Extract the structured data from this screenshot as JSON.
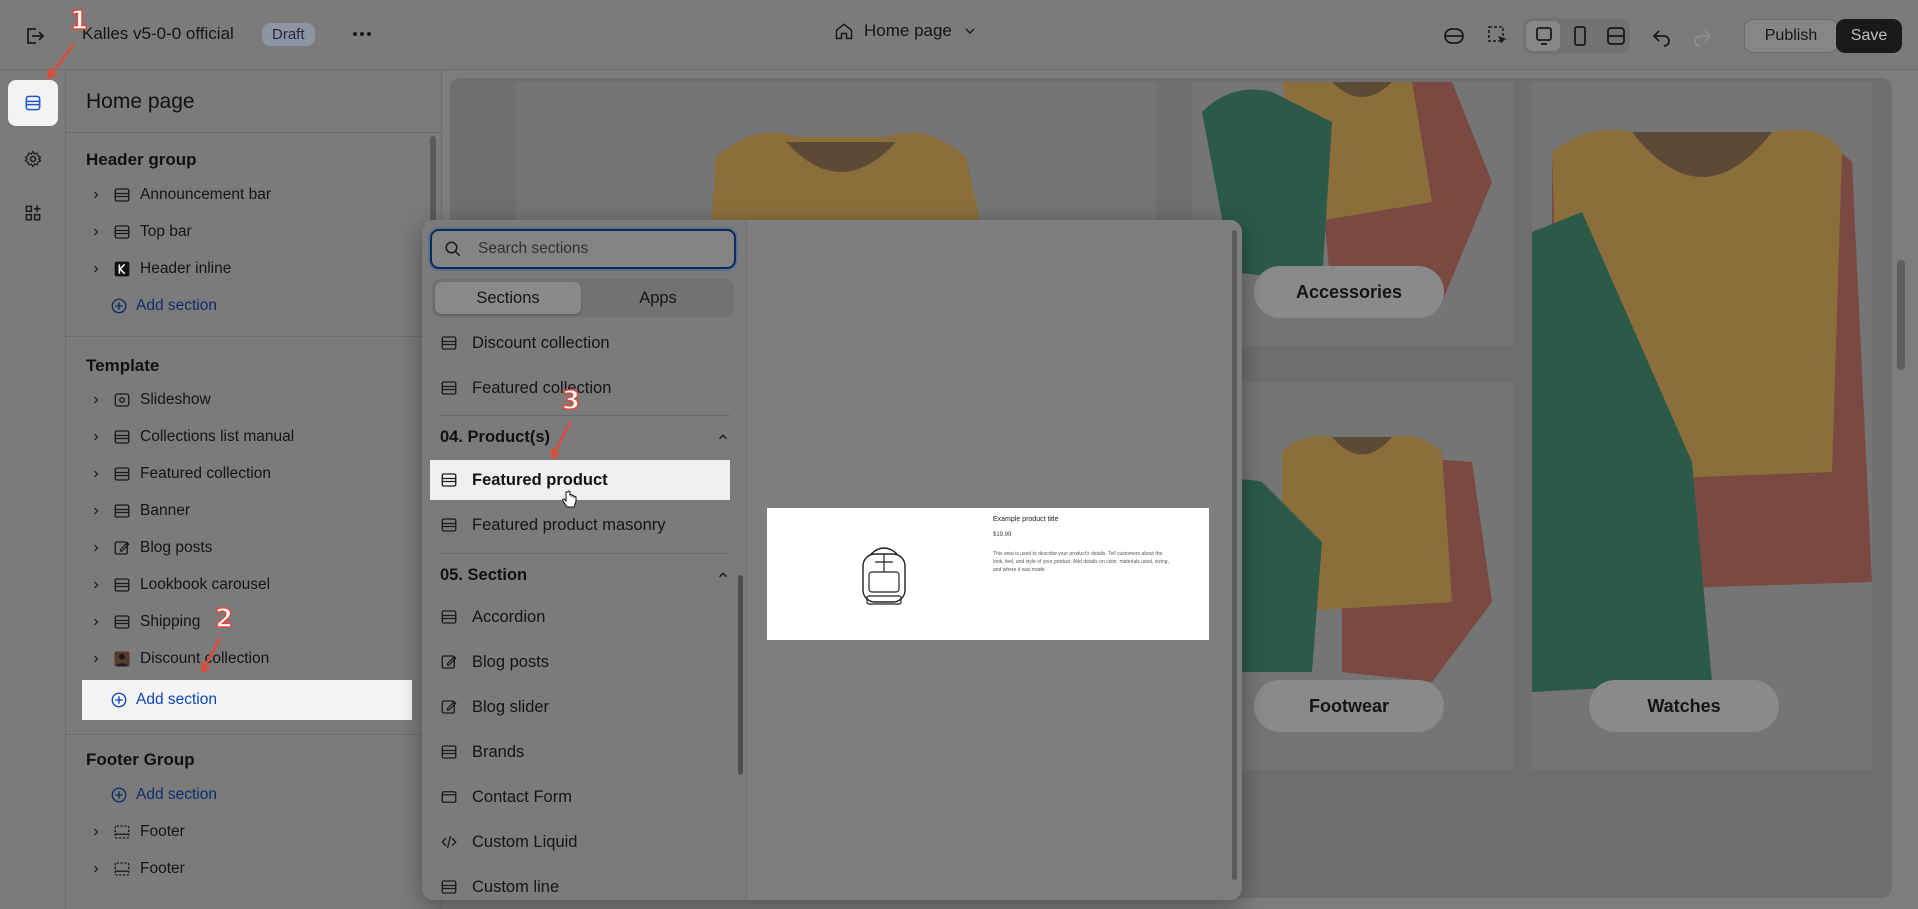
{
  "topbar": {
    "store_name": "Kalles v5-0-0 official",
    "status_badge": "Draft",
    "page_selector": "Home page",
    "publish_label": "Publish",
    "save_label": "Save"
  },
  "sidebar": {
    "title": "Home page",
    "header_group": {
      "heading": "Header group",
      "items": [
        {
          "label": "Announcement bar",
          "icon": "section-icon"
        },
        {
          "label": "Top bar",
          "icon": "section-icon"
        },
        {
          "label": "Header inline",
          "icon": "k-logo-icon"
        }
      ],
      "add_label": "Add section"
    },
    "template": {
      "heading": "Template",
      "items": [
        {
          "label": "Slideshow",
          "icon": "slideshow-icon"
        },
        {
          "label": "Collections list manual",
          "icon": "section-icon"
        },
        {
          "label": "Featured collection",
          "icon": "section-icon"
        },
        {
          "label": "Banner",
          "icon": "section-icon"
        },
        {
          "label": "Blog posts",
          "icon": "edit-icon"
        },
        {
          "label": "Lookbook carousel",
          "icon": "section-icon"
        },
        {
          "label": "Shipping",
          "icon": "section-icon"
        },
        {
          "label": "Discount collection",
          "icon": "person-image-icon"
        }
      ],
      "add_label": "Add section"
    },
    "footer_group": {
      "heading": "Footer Group",
      "add_label": "Add section",
      "items": [
        {
          "label": "Footer",
          "icon": "footer-icon"
        },
        {
          "label": "Footer",
          "icon": "footer-icon"
        }
      ]
    }
  },
  "picker": {
    "search_placeholder": "Search sections",
    "tabs": [
      "Sections",
      "Apps"
    ],
    "top_items": [
      "Discount collection",
      "Featured collection"
    ],
    "cat_products": "04. Product(s)",
    "product_items": [
      "Featured product",
      "Featured product masonry"
    ],
    "cat_section": "05. Section",
    "section_items": [
      {
        "label": "Accordion",
        "icon": "section-icon"
      },
      {
        "label": "Blog posts",
        "icon": "edit-icon"
      },
      {
        "label": "Blog slider",
        "icon": "edit-icon"
      },
      {
        "label": "Brands",
        "icon": "section-icon"
      },
      {
        "label": "Contact Form",
        "icon": "mail-icon"
      },
      {
        "label": "Custom Liquid",
        "icon": "code-icon"
      },
      {
        "label": "Custom line",
        "icon": "section-icon"
      }
    ],
    "preview": {
      "title": "Example product title",
      "price": "$19.99",
      "description": "This area is used to describe your product's details. Tell customers about the look, feel, and style of your product. Add details on color, materials used, sizing, and where it was made."
    }
  },
  "canvas": {
    "categories": [
      "Accessories",
      "Footwear",
      "Watches"
    ]
  },
  "annotations": [
    "1",
    "2",
    "3"
  ],
  "colors": {
    "accent_link": "#0b45b5",
    "annotation": "#e04a3a",
    "save_button": "#1a1a1a"
  }
}
